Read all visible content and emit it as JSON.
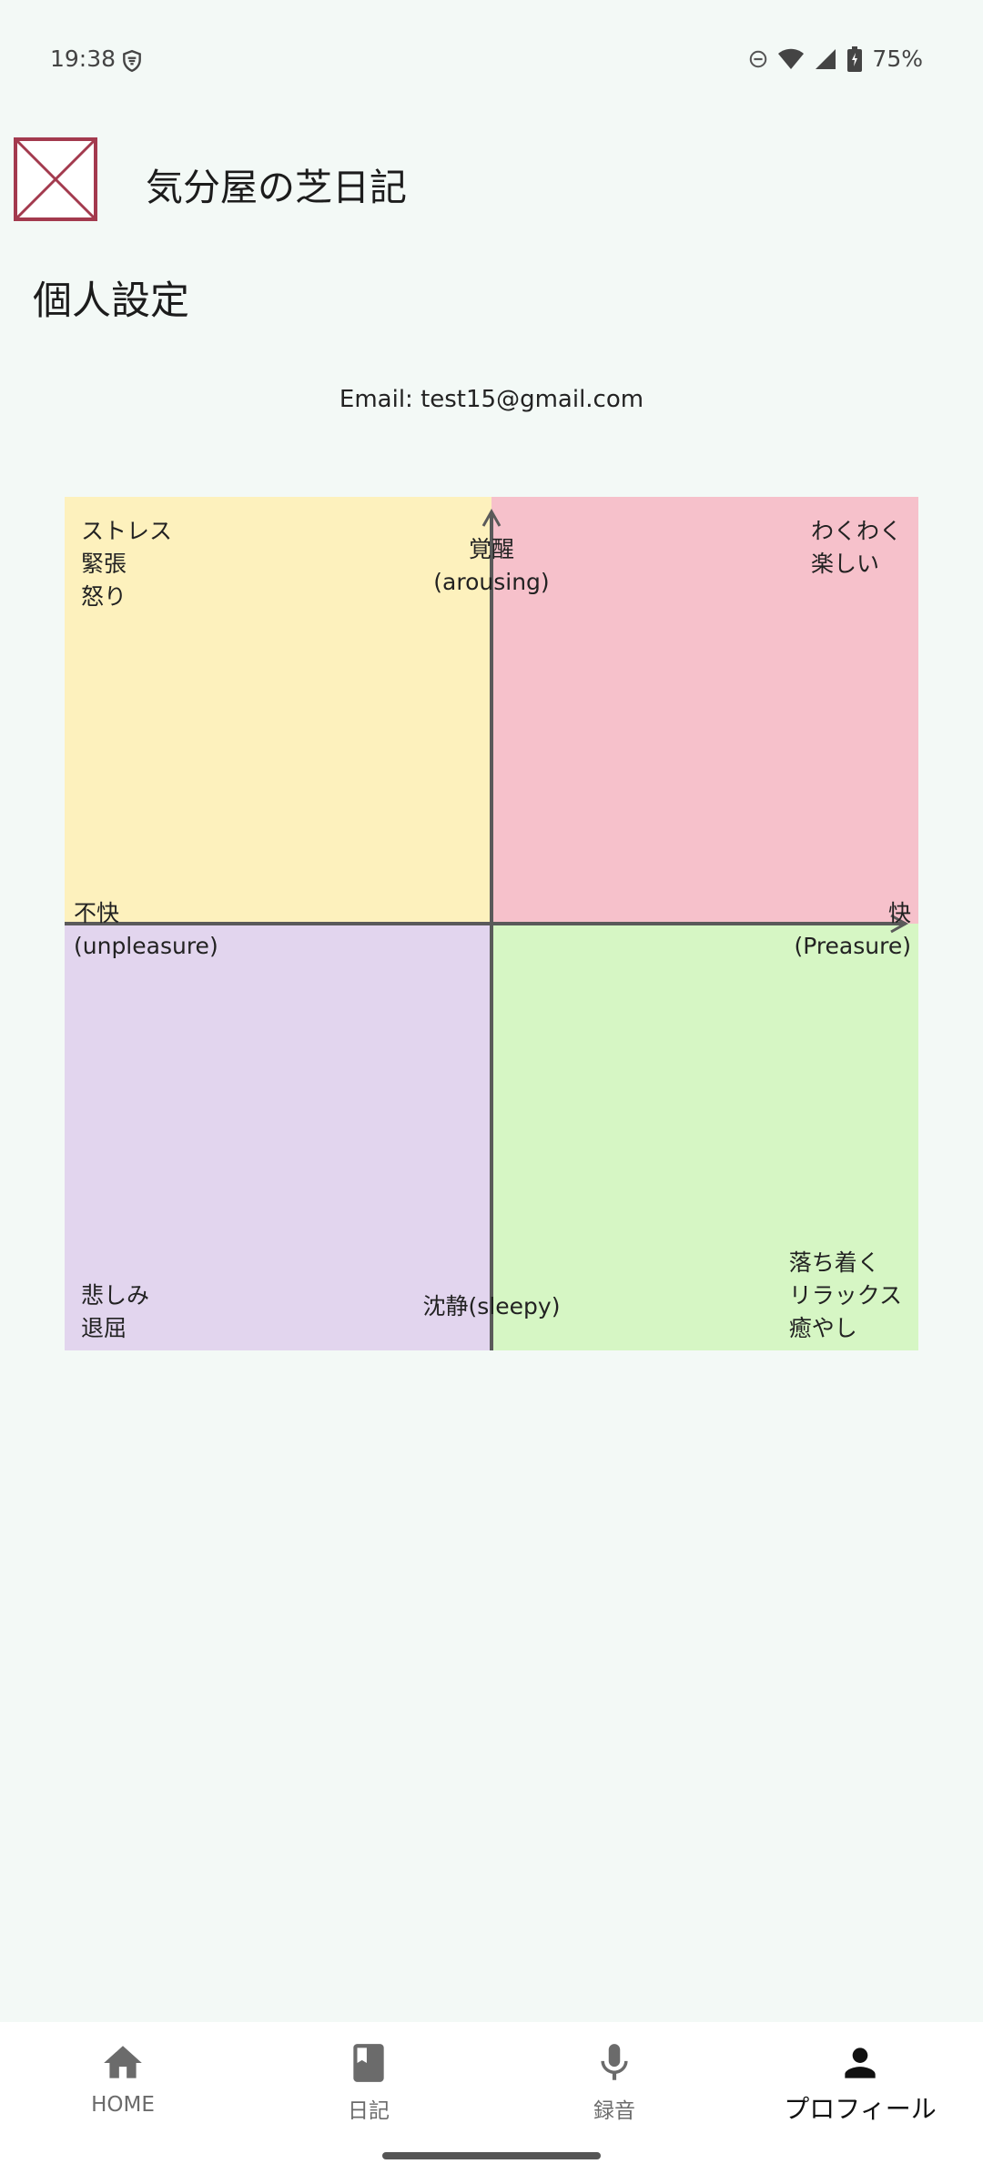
{
  "status_bar": {
    "time": "19:38",
    "battery": "75%"
  },
  "app": {
    "title": "気分屋の芝日記"
  },
  "page": {
    "title": "個人設定",
    "email_line": "Email: test15@gmail.com"
  },
  "mood_grid": {
    "colors": {
      "top_left": "#fdf1bd",
      "top_right": "#f6c1cb",
      "bottom_left": "#e2d5ee",
      "bottom_right": "#d6f6c4"
    },
    "axis": {
      "top": [
        "覚醒",
        "(arousing)"
      ],
      "bottom": "沈静(sleepy)",
      "left": [
        "不快",
        "(unpleasure)"
      ],
      "right": [
        "快",
        "(Preasure)"
      ]
    },
    "quadrants": {
      "top_left": [
        "ストレス",
        "緊張",
        "怒り"
      ],
      "top_right": [
        "わくわく",
        "楽しい"
      ],
      "bottom_left": [
        "悲しみ",
        "退屈"
      ],
      "bottom_right": [
        "落ち着く",
        "リラックス",
        "癒やし"
      ]
    }
  },
  "bottom_nav": {
    "items": [
      {
        "label": "HOME",
        "icon": "home-icon"
      },
      {
        "label": "日記",
        "icon": "book-icon"
      },
      {
        "label": "録音",
        "icon": "mic-icon"
      },
      {
        "label": "プロフィール",
        "icon": "person-icon"
      }
    ],
    "active": "プロフィール"
  }
}
